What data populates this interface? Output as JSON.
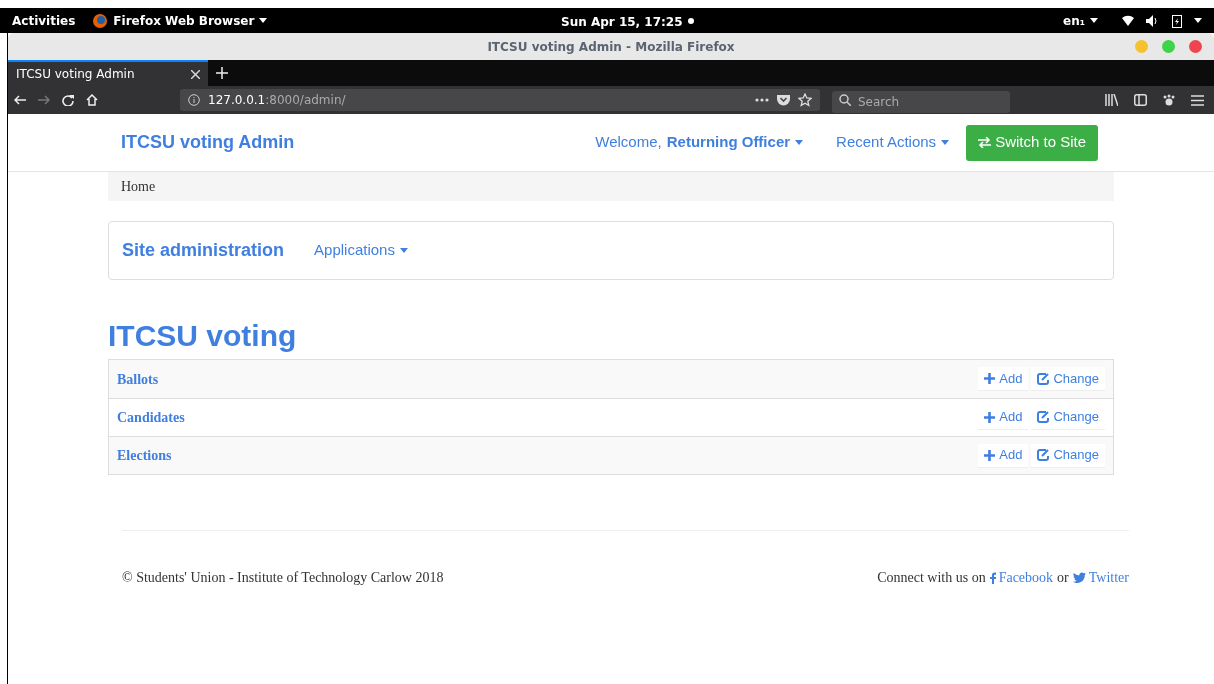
{
  "system_bar": {
    "activities": "Activities",
    "app_menu": "Firefox Web Browser",
    "clock": "Sun Apr 15, 17:25",
    "keyboard_layout": "en₁"
  },
  "window": {
    "title": "ITCSU voting Admin - Mozilla Firefox"
  },
  "tabs": [
    {
      "label": "ITCSU voting Admin",
      "selected": true
    }
  ],
  "address_bar": {
    "host": "127.0.0.1",
    "path": ":8000/admin/"
  },
  "search": {
    "placeholder": "Search"
  },
  "site": {
    "brand": "ITCSU voting Admin",
    "welcome": "Welcome,",
    "user": "Returning Officer",
    "recent_actions": "Recent Actions",
    "switch_button": "Switch to Site"
  },
  "breadcrumb": [
    "Home"
  ],
  "admin_bar": {
    "title": "Site administration",
    "applications": "Applications"
  },
  "app": {
    "title": "ITCSU voting",
    "models": [
      {
        "name": "Ballots",
        "add": "Add",
        "change": "Change"
      },
      {
        "name": "Candidates",
        "add": "Add",
        "change": "Change"
      },
      {
        "name": "Elections",
        "add": "Add",
        "change": "Change"
      }
    ]
  },
  "footer": {
    "copyright": "© Students' Union - Institute of Technology Carlow 2018",
    "connect": "Connect with us on",
    "facebook": "Facebook",
    "or": "or",
    "twitter": "Twitter"
  }
}
